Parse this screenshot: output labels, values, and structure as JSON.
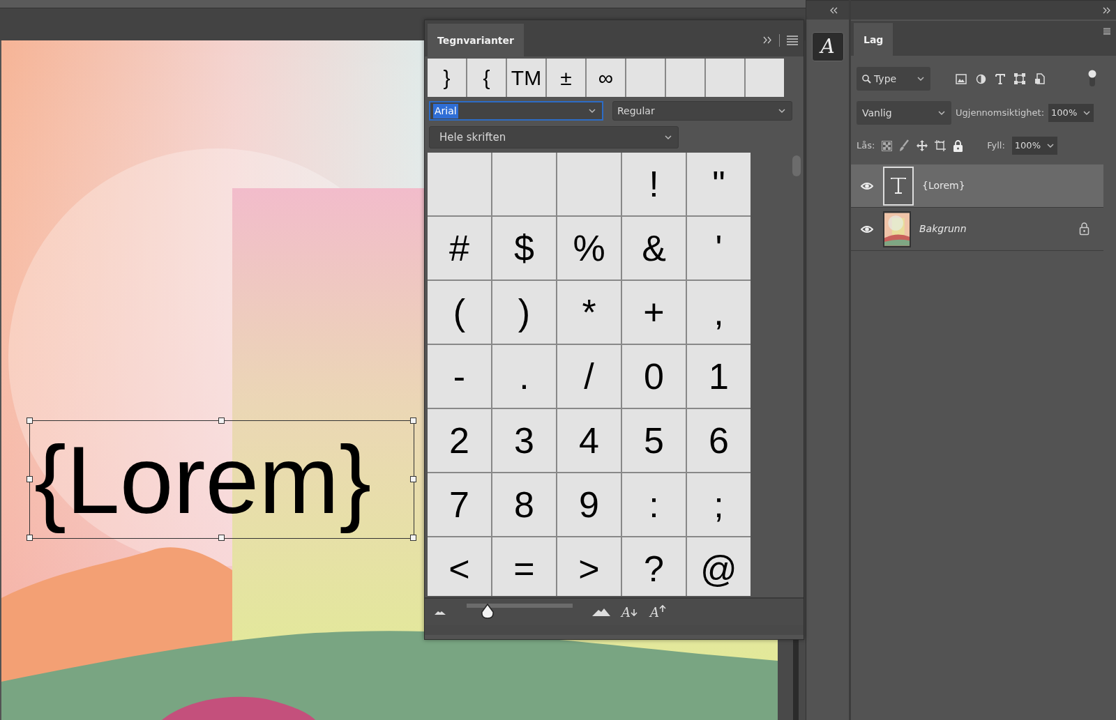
{
  "canvas": {
    "text": "{Lorem}",
    "transform_box": true
  },
  "glyphs_panel": {
    "tab": {
      "label": "Tegnvarianter",
      "selected": true
    },
    "recent_glyphs": [
      {
        "kind": "glyph",
        "glyph": "}"
      },
      {
        "kind": "glyph",
        "glyph": "{"
      },
      {
        "kind": "glyph",
        "glyph": "TM"
      },
      {
        "kind": "glyph",
        "glyph": "±"
      },
      {
        "kind": "glyph",
        "glyph": "∞"
      },
      {
        "kind": "blank"
      },
      {
        "kind": "blank"
      },
      {
        "kind": "blank"
      },
      {
        "kind": "blank"
      }
    ],
    "font_family": {
      "value": "Arial",
      "highlighted": true
    },
    "font_style": {
      "value": "Regular"
    },
    "subset": {
      "value": "Hele skriften"
    },
    "glyphs": [
      {
        "kind": "blank"
      },
      {
        "kind": "blank"
      },
      {
        "kind": "blank"
      },
      {
        "kind": "glyph",
        "glyph": "!"
      },
      {
        "kind": "glyph",
        "glyph": "\""
      },
      {
        "kind": "glyph",
        "glyph": "#"
      },
      {
        "kind": "glyph",
        "glyph": "$"
      },
      {
        "kind": "glyph",
        "glyph": "%"
      },
      {
        "kind": "glyph",
        "glyph": "&"
      },
      {
        "kind": "glyph",
        "glyph": "'"
      },
      {
        "kind": "glyph",
        "glyph": "("
      },
      {
        "kind": "glyph",
        "glyph": ")"
      },
      {
        "kind": "glyph",
        "glyph": "*"
      },
      {
        "kind": "glyph",
        "glyph": "+"
      },
      {
        "kind": "glyph",
        "glyph": ","
      },
      {
        "kind": "glyph",
        "glyph": "-"
      },
      {
        "kind": "glyph",
        "glyph": "."
      },
      {
        "kind": "glyph",
        "glyph": "/"
      },
      {
        "kind": "glyph",
        "glyph": "0"
      },
      {
        "kind": "glyph",
        "glyph": "1"
      },
      {
        "kind": "glyph",
        "glyph": "2"
      },
      {
        "kind": "glyph",
        "glyph": "3"
      },
      {
        "kind": "glyph",
        "glyph": "4"
      },
      {
        "kind": "glyph",
        "glyph": "5"
      },
      {
        "kind": "glyph",
        "glyph": "6"
      },
      {
        "kind": "glyph",
        "glyph": "7"
      },
      {
        "kind": "glyph",
        "glyph": "8"
      },
      {
        "kind": "glyph",
        "glyph": "9"
      },
      {
        "kind": "glyph",
        "glyph": ":"
      },
      {
        "kind": "glyph",
        "glyph": ";"
      },
      {
        "kind": "glyph",
        "glyph": "<"
      },
      {
        "kind": "glyph",
        "glyph": "="
      },
      {
        "kind": "glyph",
        "glyph": ">"
      },
      {
        "kind": "glyph",
        "glyph": "?"
      },
      {
        "kind": "glyph",
        "glyph": "@"
      }
    ],
    "size_slider": {
      "level": 0.2
    },
    "footer_buttons": [
      {
        "label": "A",
        "kind": "decrease"
      },
      {
        "label": "A",
        "kind": "increase"
      }
    ]
  },
  "dock": {
    "glyph_button": {
      "label": "A"
    }
  },
  "layers_panel": {
    "tab": {
      "label": "Lag",
      "selected": true
    },
    "filter": {
      "value": "Type",
      "on": true
    },
    "blend_mode": {
      "value": "Vanlig"
    },
    "opacity": {
      "label": "Ugjennomsiktighet:",
      "value": "100%"
    },
    "lock": {
      "label": "Lås:"
    },
    "fill": {
      "label": "Fyll:",
      "value": "100%"
    },
    "layers": [
      {
        "name": "{Lorem}",
        "kind": "text",
        "selected": true,
        "visible": true,
        "locked": false
      },
      {
        "name": "Bakgrunn",
        "kind": "background",
        "selected": false,
        "visible": true,
        "locked": true
      }
    ]
  }
}
